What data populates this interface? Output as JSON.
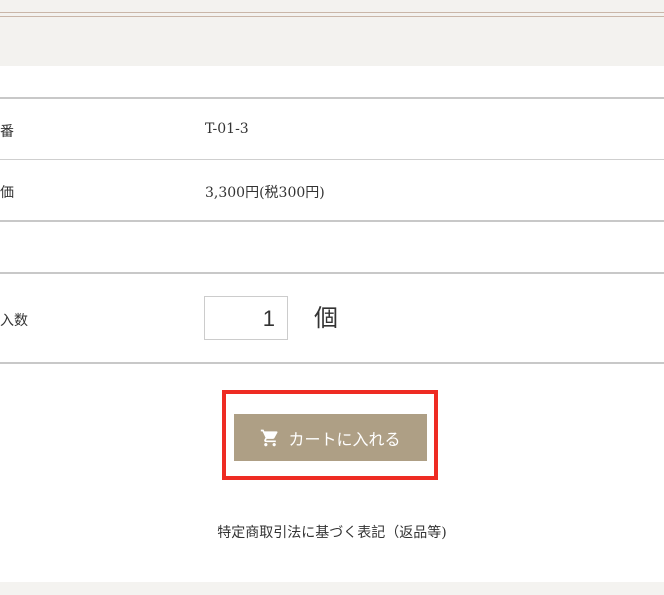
{
  "product_info": {
    "rows": [
      {
        "label": "番",
        "value": "T-01-3"
      },
      {
        "label": "価",
        "value": "3,300円(税300円)"
      }
    ]
  },
  "quantity": {
    "label": "入数",
    "value": "1",
    "unit": "個"
  },
  "cart_button": {
    "label": "カートに入れる",
    "icon": "cart-icon"
  },
  "footer": {
    "link_text": "特定商取引法に基づく表記（返品等)"
  },
  "colors": {
    "button_bg": "#ae9f85",
    "highlight_border": "#ee2b23",
    "page_bg": "#f4f3f0"
  }
}
